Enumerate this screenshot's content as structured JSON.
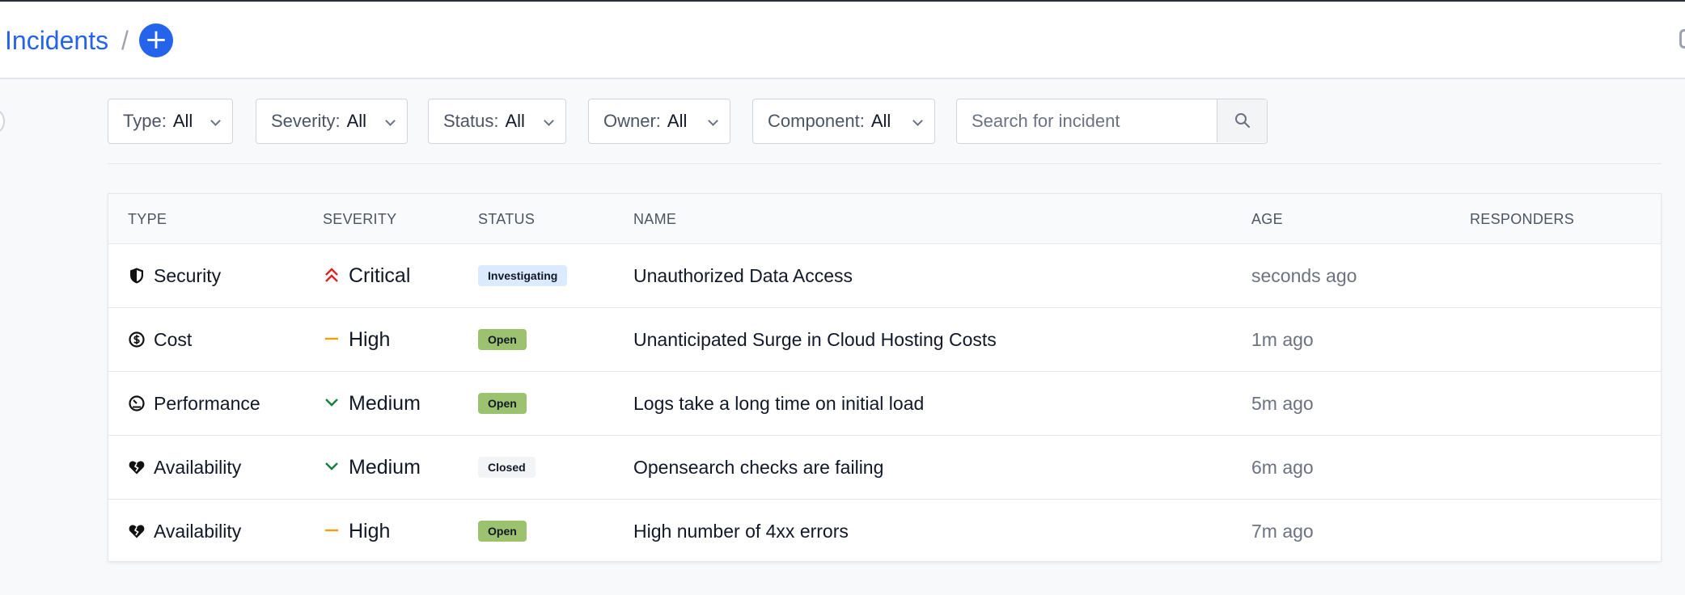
{
  "header": {
    "breadcrumb": "Incidents",
    "separator": "/",
    "add_label": "+"
  },
  "filters": [
    {
      "label": "Type:",
      "value": "All"
    },
    {
      "label": "Severity:",
      "value": "All"
    },
    {
      "label": "Status:",
      "value": "All"
    },
    {
      "label": "Owner:",
      "value": "All"
    },
    {
      "label": "Component:",
      "value": "All"
    }
  ],
  "search": {
    "placeholder": "Search for incident",
    "value": ""
  },
  "table": {
    "columns": [
      "TYPE",
      "SEVERITY",
      "STATUS",
      "NAME",
      "AGE",
      "RESPONDERS"
    ],
    "rows": [
      {
        "type": "Security",
        "type_icon": "shield-icon",
        "severity": "Critical",
        "severity_icon": "double-chevron-up-icon",
        "status": "Investigating",
        "name": "Unauthorized Data Access",
        "age": "seconds ago",
        "responders": ""
      },
      {
        "type": "Cost",
        "type_icon": "dollar-circle-icon",
        "severity": "High",
        "severity_icon": "dash-icon",
        "status": "Open",
        "name": "Unanticipated Surge in Cloud Hosting Costs",
        "age": "1m ago",
        "responders": ""
      },
      {
        "type": "Performance",
        "type_icon": "speedometer-icon",
        "severity": "Medium",
        "severity_icon": "chevron-down-icon",
        "status": "Open",
        "name": "Logs take a long time on initial load",
        "age": "5m ago",
        "responders": ""
      },
      {
        "type": "Availability",
        "type_icon": "broken-heart-icon",
        "severity": "Medium",
        "severity_icon": "chevron-down-icon",
        "status": "Closed",
        "name": "Opensearch checks are failing",
        "age": "6m ago",
        "responders": ""
      },
      {
        "type": "Availability",
        "type_icon": "broken-heart-icon",
        "severity": "High",
        "severity_icon": "dash-icon",
        "status": "Open",
        "name": "High number of 4xx errors",
        "age": "7m ago",
        "responders": ""
      }
    ]
  },
  "colors": {
    "accent": "#2563eb",
    "critical": "#dc2626",
    "high": "#f59e0b",
    "medium": "#15803d",
    "open_badge": "#9cc26f",
    "investigating_badge": "#dbeafe",
    "closed_badge": "#f3f4f6"
  }
}
